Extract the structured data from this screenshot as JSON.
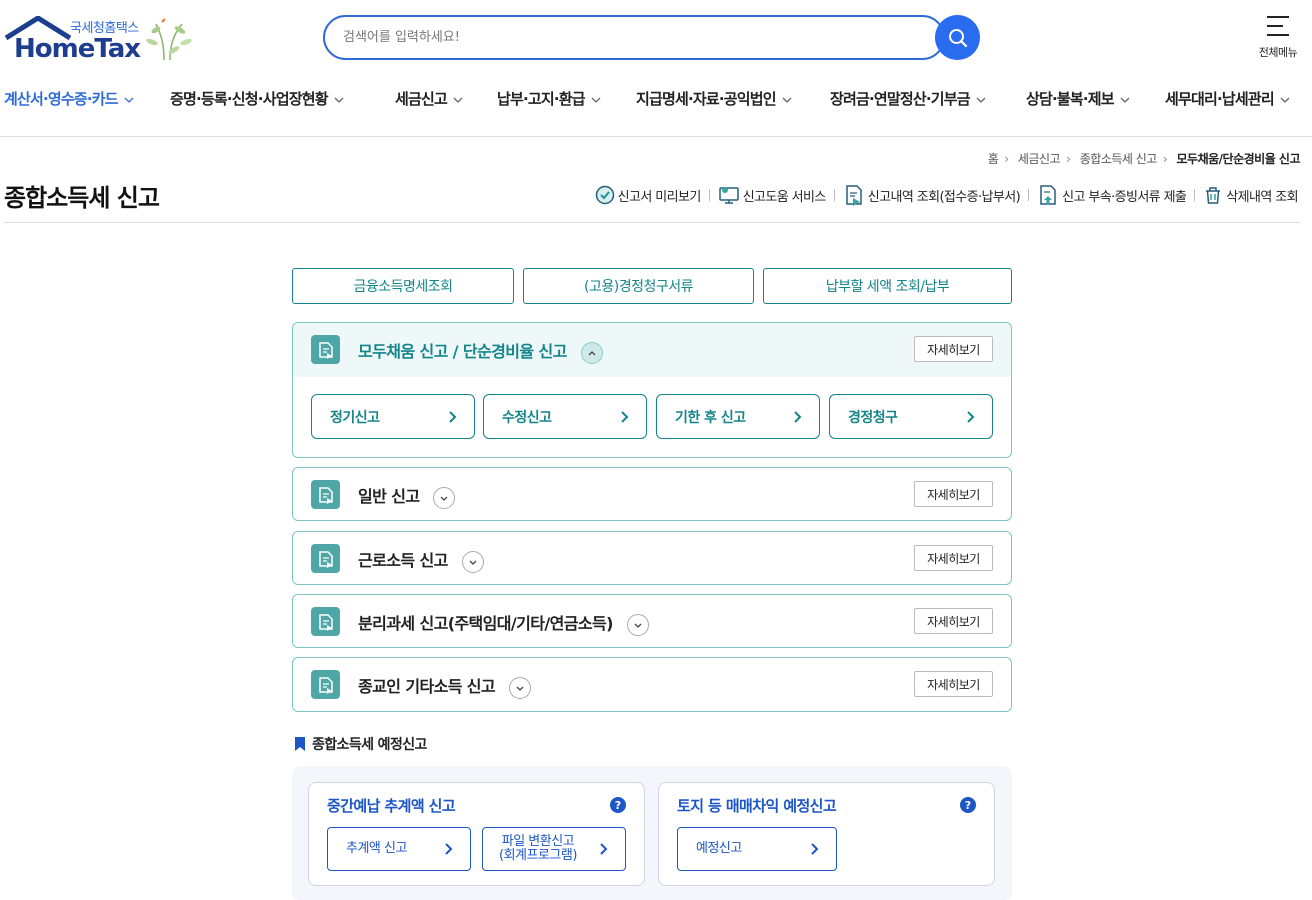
{
  "header": {
    "logo_sub": "국세청홈택스",
    "logo_main": "HomeTax",
    "search_placeholder": "검색어를 입력하세요!",
    "all_menu_label": "전체메뉴"
  },
  "gnb": [
    {
      "label": "계산서·영수증·카드",
      "active": true
    },
    {
      "label": "증명·등록·신청·사업장현황",
      "active": false
    },
    {
      "label": "세금신고",
      "active": false
    },
    {
      "label": "납부·고지·환급",
      "active": false
    },
    {
      "label": "지급명세·자료·공익법인",
      "active": false
    },
    {
      "label": "장려금·연말정산·기부금",
      "active": false
    },
    {
      "label": "상담·불복·제보",
      "active": false
    },
    {
      "label": "세무대리·납세관리",
      "active": false
    }
  ],
  "breadcrumb": [
    "홈",
    "세금신고",
    "종합소득세 신고",
    "모두채움/단순경비율 신고"
  ],
  "page_title": "종합소득세 신고",
  "toolbar": [
    {
      "label": "신고서 미리보기",
      "icon": "check-circle-icon"
    },
    {
      "label": "신고도움 서비스",
      "icon": "monitor-help-icon"
    },
    {
      "label": "신고내역 조회(접수증·납부서)",
      "icon": "document-search-icon"
    },
    {
      "label": "신고 부속·증빙서류 제출",
      "icon": "document-upload-icon"
    },
    {
      "label": "삭제내역 조회",
      "icon": "trash-icon"
    }
  ],
  "top_buttons": [
    "금융소득명세조회",
    "(고용)경정청구서류",
    "납부할 세액 조회/납부"
  ],
  "accordions": [
    {
      "title": "모두채움 신고 / 단순경비율 신고",
      "detail": "자세히보기",
      "open": true,
      "sub_buttons": [
        "정기신고",
        "수정신고",
        "기한 후 신고",
        "경정청구"
      ]
    },
    {
      "title": "일반 신고",
      "detail": "자세히보기",
      "open": false
    },
    {
      "title": "근로소득 신고",
      "detail": "자세히보기",
      "open": false
    },
    {
      "title": "분리과세 신고(주택임대/기타/연금소득)",
      "detail": "자세히보기",
      "open": false
    },
    {
      "title": "종교인 기타소득 신고",
      "detail": "자세히보기",
      "open": false
    }
  ],
  "estimate": {
    "section_title": "종합소득세 예정신고",
    "cards": [
      {
        "title": "중간예납 추계액 신고",
        "help": "?",
        "buttons": [
          {
            "line1": "추계액 신고",
            "line2": ""
          },
          {
            "line1": "파일 변환신고",
            "line2": "(회계프로그램)"
          }
        ]
      },
      {
        "title": "토지 등 매매차익 예정신고",
        "help": "?",
        "buttons": [
          {
            "line1": "예정신고",
            "line2": ""
          }
        ]
      }
    ]
  },
  "colors": {
    "primary_blue": "#2f6bd8",
    "teal": "#14858a",
    "card_blue": "#1d56c7"
  }
}
